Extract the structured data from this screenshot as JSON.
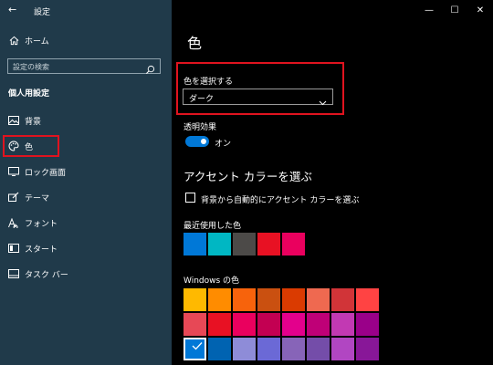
{
  "window": {
    "back_glyph": "←",
    "title": "設定",
    "minimize": "—",
    "maximize": "☐",
    "close": "✕"
  },
  "sidebar": {
    "home": "ホーム",
    "search_placeholder": "設定の検索",
    "section": "個人用設定",
    "items": [
      {
        "label": "背景",
        "icon": "picture-icon"
      },
      {
        "label": "色",
        "icon": "palette-icon",
        "selected": true
      },
      {
        "label": "ロック画面",
        "icon": "lock-screen-icon"
      },
      {
        "label": "テーマ",
        "icon": "brush-icon"
      },
      {
        "label": "フォント",
        "icon": "font-icon"
      },
      {
        "label": "スタート",
        "icon": "start-icon"
      },
      {
        "label": "タスク バー",
        "icon": "taskbar-icon"
      }
    ]
  },
  "main": {
    "title": "色",
    "choose_color_label": "色を選択する",
    "choose_color_value": "ダーク",
    "transparency_label": "透明効果",
    "transparency_state": "オン",
    "accent_heading": "アクセント カラーを選ぶ",
    "auto_accent_label": "背景から自動的にアクセント カラーを選ぶ",
    "recent_label": "最近使用した色",
    "recent_colors": [
      "#0078d7",
      "#00b7c3",
      "#4c4a48",
      "#e81123",
      "#ea005e"
    ],
    "windows_label": "Windows の色",
    "windows_colors": [
      "#ffb900",
      "#ff8c00",
      "#f7630c",
      "#ca5010",
      "#da3b01",
      "#ef6950",
      "#d13438",
      "#ff4343",
      "#e74856",
      "#e81123",
      "#ea005e",
      "#c30052",
      "#e3008c",
      "#bf0077",
      "#c239b3",
      "#9a0089",
      "#0078d7",
      "#0063b1",
      "#8e8cd8",
      "#6b69d6",
      "#8764b8",
      "#744da9",
      "#b146c2",
      "#881798"
    ],
    "selected_windows_color": "#0078d7"
  },
  "colors": {
    "sidebar_bg": "#203a4a",
    "accent": "#0078d7",
    "highlight_border": "#e0131f"
  }
}
